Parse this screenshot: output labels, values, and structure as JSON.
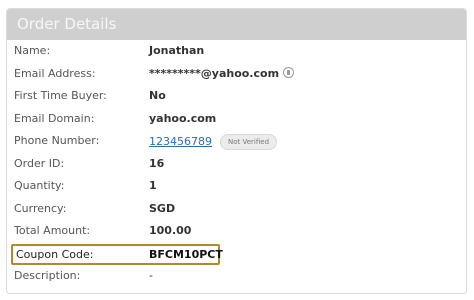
{
  "panel": {
    "title": "Order Details"
  },
  "rows": [
    {
      "label": "Name:",
      "value": "Jonathan"
    },
    {
      "label": "Email Address:",
      "value": "*********@yahoo.com"
    },
    {
      "label": "First Time Buyer:",
      "value": "No"
    },
    {
      "label": "Email Domain:",
      "value": "yahoo.com"
    },
    {
      "label": "Phone Number:",
      "value": "123456789",
      "badge": "Not Verified"
    },
    {
      "label": "Order ID:",
      "value": "16"
    },
    {
      "label": "Quantity:",
      "value": "1"
    },
    {
      "label": "Currency:",
      "value": "SGD"
    },
    {
      "label": "Total Amount:",
      "value": "100.00"
    },
    {
      "label": "Coupon Code:",
      "value": "BFCM10PCT"
    },
    {
      "label": "Description:",
      "value": "-"
    }
  ],
  "icons": {
    "email_info": "info-icon"
  },
  "colors": {
    "header_bg": "#cfcfcf",
    "highlight_border": "#b38a2a",
    "link": "#2a6fb0"
  }
}
